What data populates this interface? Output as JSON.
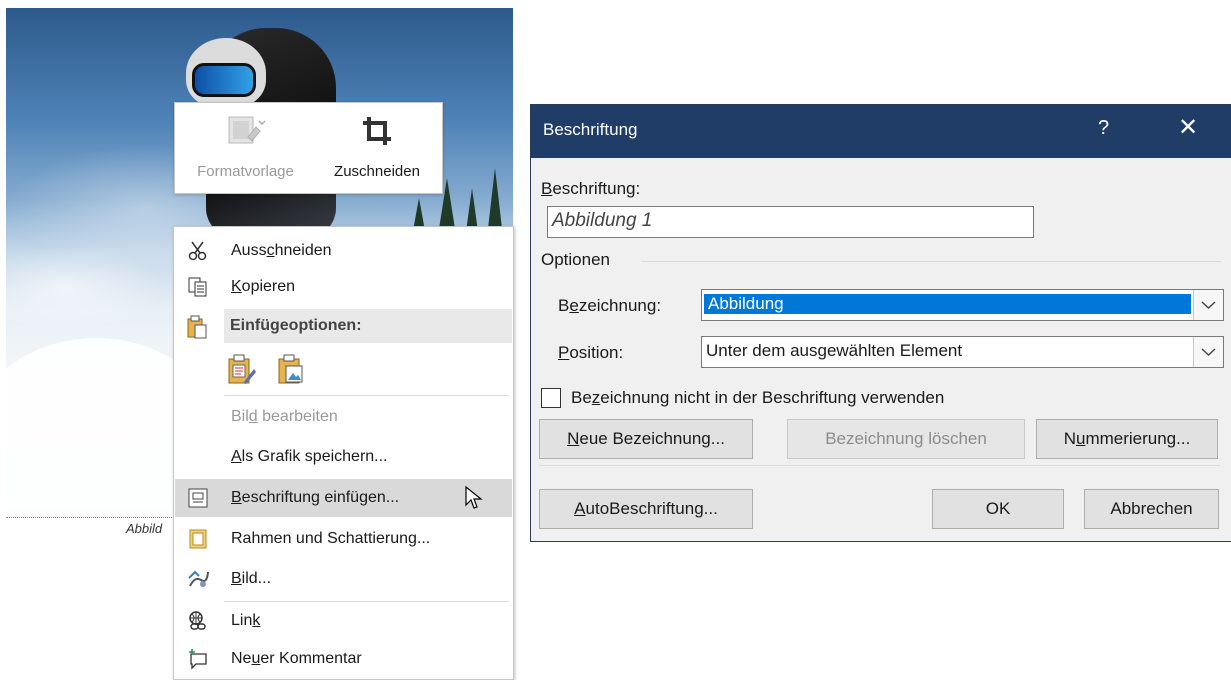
{
  "document": {
    "caption_stub": "Abbild"
  },
  "mini_toolbar": {
    "style_label": "Formatvorlage",
    "crop_label": "Zuschneiden"
  },
  "context_menu": {
    "items": [
      {
        "label_pre": "Auss",
        "label_u": "c",
        "label_post": "hneiden",
        "icon": "scissors-icon",
        "disabled": false
      },
      {
        "label_pre": "",
        "label_u": "K",
        "label_post": "opieren",
        "icon": "copy-icon",
        "disabled": false
      },
      {
        "label": "Einfügeoptionen:",
        "icon": "paste-icon",
        "section": true
      },
      {
        "label_pre": "Bil",
        "label_u": "d",
        "label_post": " bearbeiten",
        "disabled": true
      },
      {
        "label_pre": "",
        "label_u": "A",
        "label_post": "ls Grafik speichern...",
        "disabled": false
      },
      {
        "label_pre": "",
        "label_u": "B",
        "label_post": "eschriftung einfügen...",
        "icon": "caption-icon",
        "highlighted": true
      },
      {
        "label": "Rahmen und Schattierung...",
        "icon": "border-shading-icon"
      },
      {
        "label_pre": "",
        "label_u": "B",
        "label_post": "ild...",
        "icon": "picture-format-icon"
      },
      {
        "label_pre": "Lin",
        "label_u": "k",
        "label_post": "",
        "icon": "link-icon"
      },
      {
        "label_pre": "Ne",
        "label_u": "u",
        "label_post": "er Kommentar",
        "icon": "new-comment-icon"
      }
    ]
  },
  "dialog": {
    "title": "Beschriftung",
    "help": "?",
    "close": "✕",
    "caption_label_u": "B",
    "caption_label_rest": "eschriftung:",
    "caption_value": "Abbildung 1",
    "options_group": "Optionen",
    "label_field_pre": "B",
    "label_field_u": "e",
    "label_field_post": "zeichnung:",
    "label_value": "Abbildung",
    "position_label_u": "P",
    "position_label_rest": "osition:",
    "position_value": "Unter dem ausgewählten Element",
    "exclude_pre": "Be",
    "exclude_u": "z",
    "exclude_post": "eichnung nicht in der Beschriftung verwenden",
    "exclude_checked": false,
    "new_label_u": "N",
    "new_label_rest": "eue Bezeichnung...",
    "delete_label": "Bezeichnung löschen",
    "numbering_pre": "N",
    "numbering_u": "u",
    "numbering_post": "mmerierung...",
    "autocaption_u": "A",
    "autocaption_rest": "utoBeschriftung...",
    "ok": "OK",
    "cancel": "Abbrechen"
  },
  "colors": {
    "title_bar": "#1f3d66",
    "selection": "#0078d7",
    "menu_hover": "#d9d9d9"
  }
}
